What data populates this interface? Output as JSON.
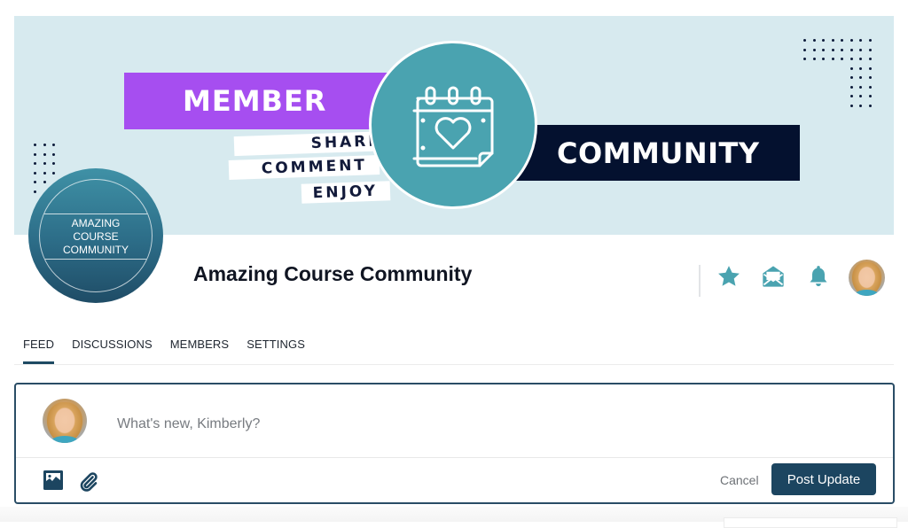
{
  "banner": {
    "headline_left": "MEMBER",
    "headline_right": "COMMUNITY",
    "taglines": [
      "SHARE",
      "COMMENT",
      "ENJOY"
    ],
    "icon": "calendar-heart-icon",
    "colors": {
      "background": "#d7eaef",
      "member_bar": "#a64ef0",
      "community_bar": "#04112f",
      "circle": "#4aa3b0"
    }
  },
  "group": {
    "logo_lines": [
      "AMAZING",
      "COURSE",
      "COMMUNITY"
    ],
    "title": "Amazing Course Community"
  },
  "header_actions": [
    {
      "name": "favorite",
      "icon": "star-icon"
    },
    {
      "name": "messages",
      "icon": "envelope-open-icon"
    },
    {
      "name": "notifications",
      "icon": "bell-icon"
    },
    {
      "name": "profile",
      "icon": "user-avatar"
    }
  ],
  "tabs": [
    {
      "label": "FEED",
      "active": true
    },
    {
      "label": "DISCUSSIONS",
      "active": false
    },
    {
      "label": "MEMBERS",
      "active": false
    },
    {
      "label": "SETTINGS",
      "active": false
    }
  ],
  "composer": {
    "placeholder": "What's new, Kimberly?",
    "value": "",
    "attach_icons": [
      "image-icon",
      "paperclip-icon"
    ],
    "cancel_label": "Cancel",
    "submit_label": "Post Update"
  },
  "theme": {
    "accent": "#4aa3b0",
    "primary": "#1c4560"
  }
}
